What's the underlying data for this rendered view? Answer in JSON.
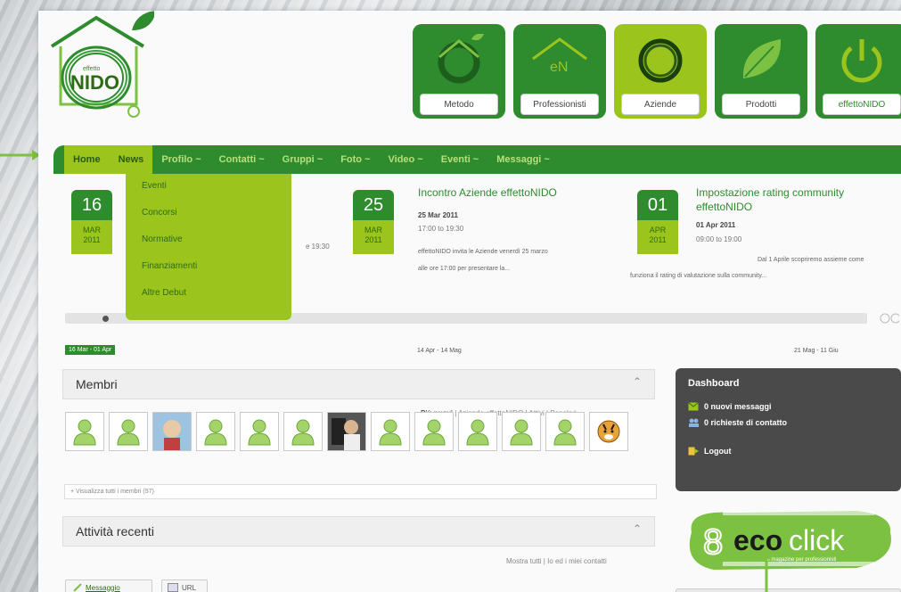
{
  "logo": {
    "text": "NIDO",
    "sub": "effetto"
  },
  "top_icons": [
    {
      "label": "Metodo",
      "active": false
    },
    {
      "label": "Professionisti",
      "active": false,
      "glyph": "eN"
    },
    {
      "label": "Aziende",
      "active": true
    },
    {
      "label": "Prodotti",
      "active": false
    },
    {
      "label": "effettoNIDO",
      "active": false
    }
  ],
  "nav": [
    {
      "label": "Home"
    },
    {
      "label": "News"
    },
    {
      "label": "Profilo ~"
    },
    {
      "label": "Contatti ~"
    },
    {
      "label": "Gruppi ~"
    },
    {
      "label": "Foto ~"
    },
    {
      "label": "Video ~"
    },
    {
      "label": "Eventi ~"
    },
    {
      "label": "Messaggi ~"
    }
  ],
  "dropdown": [
    "Eventi",
    "Concorsi",
    "Normative",
    "Finanziamenti",
    "Altre Debut"
  ],
  "events": [
    {
      "day": "16",
      "month": "MAR",
      "year": "2011",
      "partial": "e 19:30"
    },
    {
      "day": "25",
      "month": "MAR",
      "year": "2011",
      "title": "Incontro Aziende effettoNIDO",
      "date": "25 Mar 2011",
      "time": "17:00 to 19:30",
      "desc1": "effettoNIDO invita le Aziende venerdì 25 marzo",
      "desc2": "alle ore 17:00 per presentare la..."
    },
    {
      "day": "01",
      "month": "APR",
      "year": "2011",
      "title1": "Impostazione rating community",
      "title2": "effettoNIDO",
      "date": "01 Apr 2011",
      "time": "09:00 to 19:00",
      "desc1": "Dal 1 Aprile scopriremo assieme come",
      "desc2": "funziona il rating di valutazione sulla community..."
    }
  ],
  "ranges": [
    "16 Mar - 01 Apr",
    "14 Apr - 14 Mag",
    "21 Mag - 11 Giu"
  ],
  "members": {
    "title": "Membri",
    "filters_active": "Più nuovi",
    "filters": [
      "Aziende effettoNIDO",
      "Attivi",
      "Popolari"
    ],
    "showall": "+ Visualizza tutti i membri (57)",
    "avatars": [
      "user",
      "user",
      "photo",
      "user",
      "user",
      "user",
      "photo2",
      "user",
      "user",
      "user",
      "user",
      "user",
      "tiger"
    ]
  },
  "activity": {
    "title": "Attività recenti",
    "filters": "Mostra tutti | Io ed i miei contatti",
    "msg_button": "Messaggio",
    "url_button": "URL"
  },
  "dashboard": {
    "title": "Dashboard",
    "items": [
      "0 nuovi messaggi",
      "0 richieste di contatto",
      "Logout"
    ]
  },
  "ecoclick": {
    "eco": "eco",
    "click": "click",
    "tag": "il magazine per professionisti",
    "number": "8"
  },
  "colors": {
    "green": "#2e8b2e",
    "lime": "#9bc41d",
    "dark": "#4a4a4a"
  }
}
